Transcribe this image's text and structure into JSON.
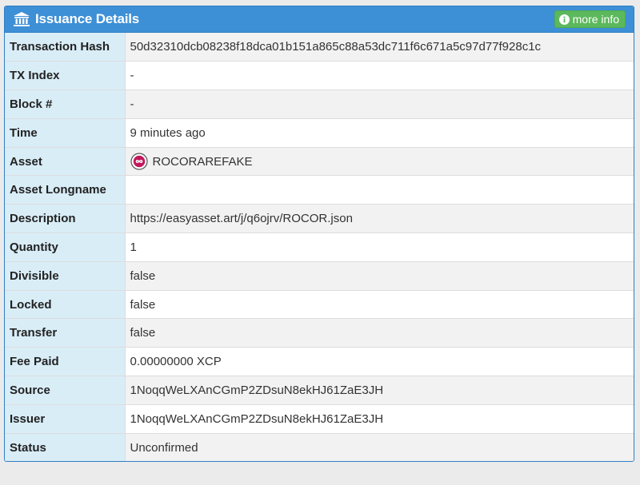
{
  "panel": {
    "title": "Issuance Details",
    "more_info_label": "more info"
  },
  "rows": [
    {
      "label": "Transaction Hash",
      "value": "50d32310dcb08238f18dca01b151a865c88a53dc711f6c671a5c97d77f928c1c"
    },
    {
      "label": "TX Index",
      "value": "-"
    },
    {
      "label": "Block #",
      "value": "-"
    },
    {
      "label": "Time",
      "value": "9 minutes ago"
    },
    {
      "label": "Asset",
      "value": "ROCORAREFAKE"
    },
    {
      "label": "Asset Longname",
      "value": ""
    },
    {
      "label": "Description",
      "value": "https://easyasset.art/j/q6ojrv/ROCOR.json"
    },
    {
      "label": "Quantity",
      "value": "1"
    },
    {
      "label": "Divisible",
      "value": "false"
    },
    {
      "label": "Locked",
      "value": "false"
    },
    {
      "label": "Transfer",
      "value": "false"
    },
    {
      "label": "Fee Paid",
      "value": "0.00000000 XCP"
    },
    {
      "label": "Source",
      "value": "1NoqqWeLXAnCGmP2ZDsuN8ekHJ61ZaE3JH"
    },
    {
      "label": "Issuer",
      "value": "1NoqqWeLXAnCGmP2ZDsuN8ekHJ61ZaE3JH"
    },
    {
      "label": "Status",
      "value": "Unconfirmed"
    }
  ],
  "colors": {
    "heading_bg": "#3d8fd6",
    "label_bg": "#d9edf7",
    "button_bg": "#5cb85c",
    "asset_icon": "#c2185b"
  },
  "icons": {
    "title": "bank-icon",
    "more_info": "info-circle-icon",
    "asset": "asset-infinity-icon"
  }
}
